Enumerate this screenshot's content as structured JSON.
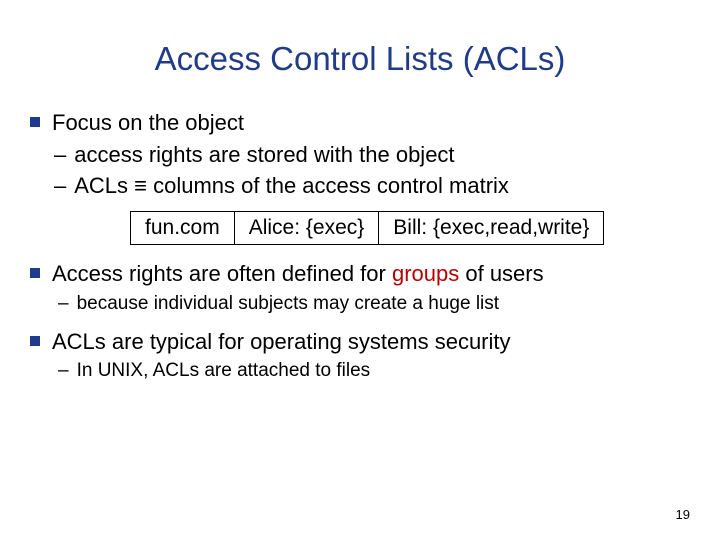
{
  "title": "Access Control Lists (ACLs)",
  "bullet1": {
    "main": "Focus on the object",
    "sub1": "access rights are stored with the object",
    "sub2": "ACLs ≡ columns of the access control matrix"
  },
  "table": {
    "c1": "fun.com",
    "c2": "Alice: {exec}",
    "c3": "Bill: {exec,read,write}"
  },
  "bullet2": {
    "pre": "Access rights are often defined for ",
    "groups": "groups",
    "post": " of users",
    "sub1": "because individual subjects may create a huge list"
  },
  "bullet3": {
    "main": "ACLs are typical for operating systems security",
    "sub1": "In UNIX, ACLs are attached to files"
  },
  "page": "19"
}
